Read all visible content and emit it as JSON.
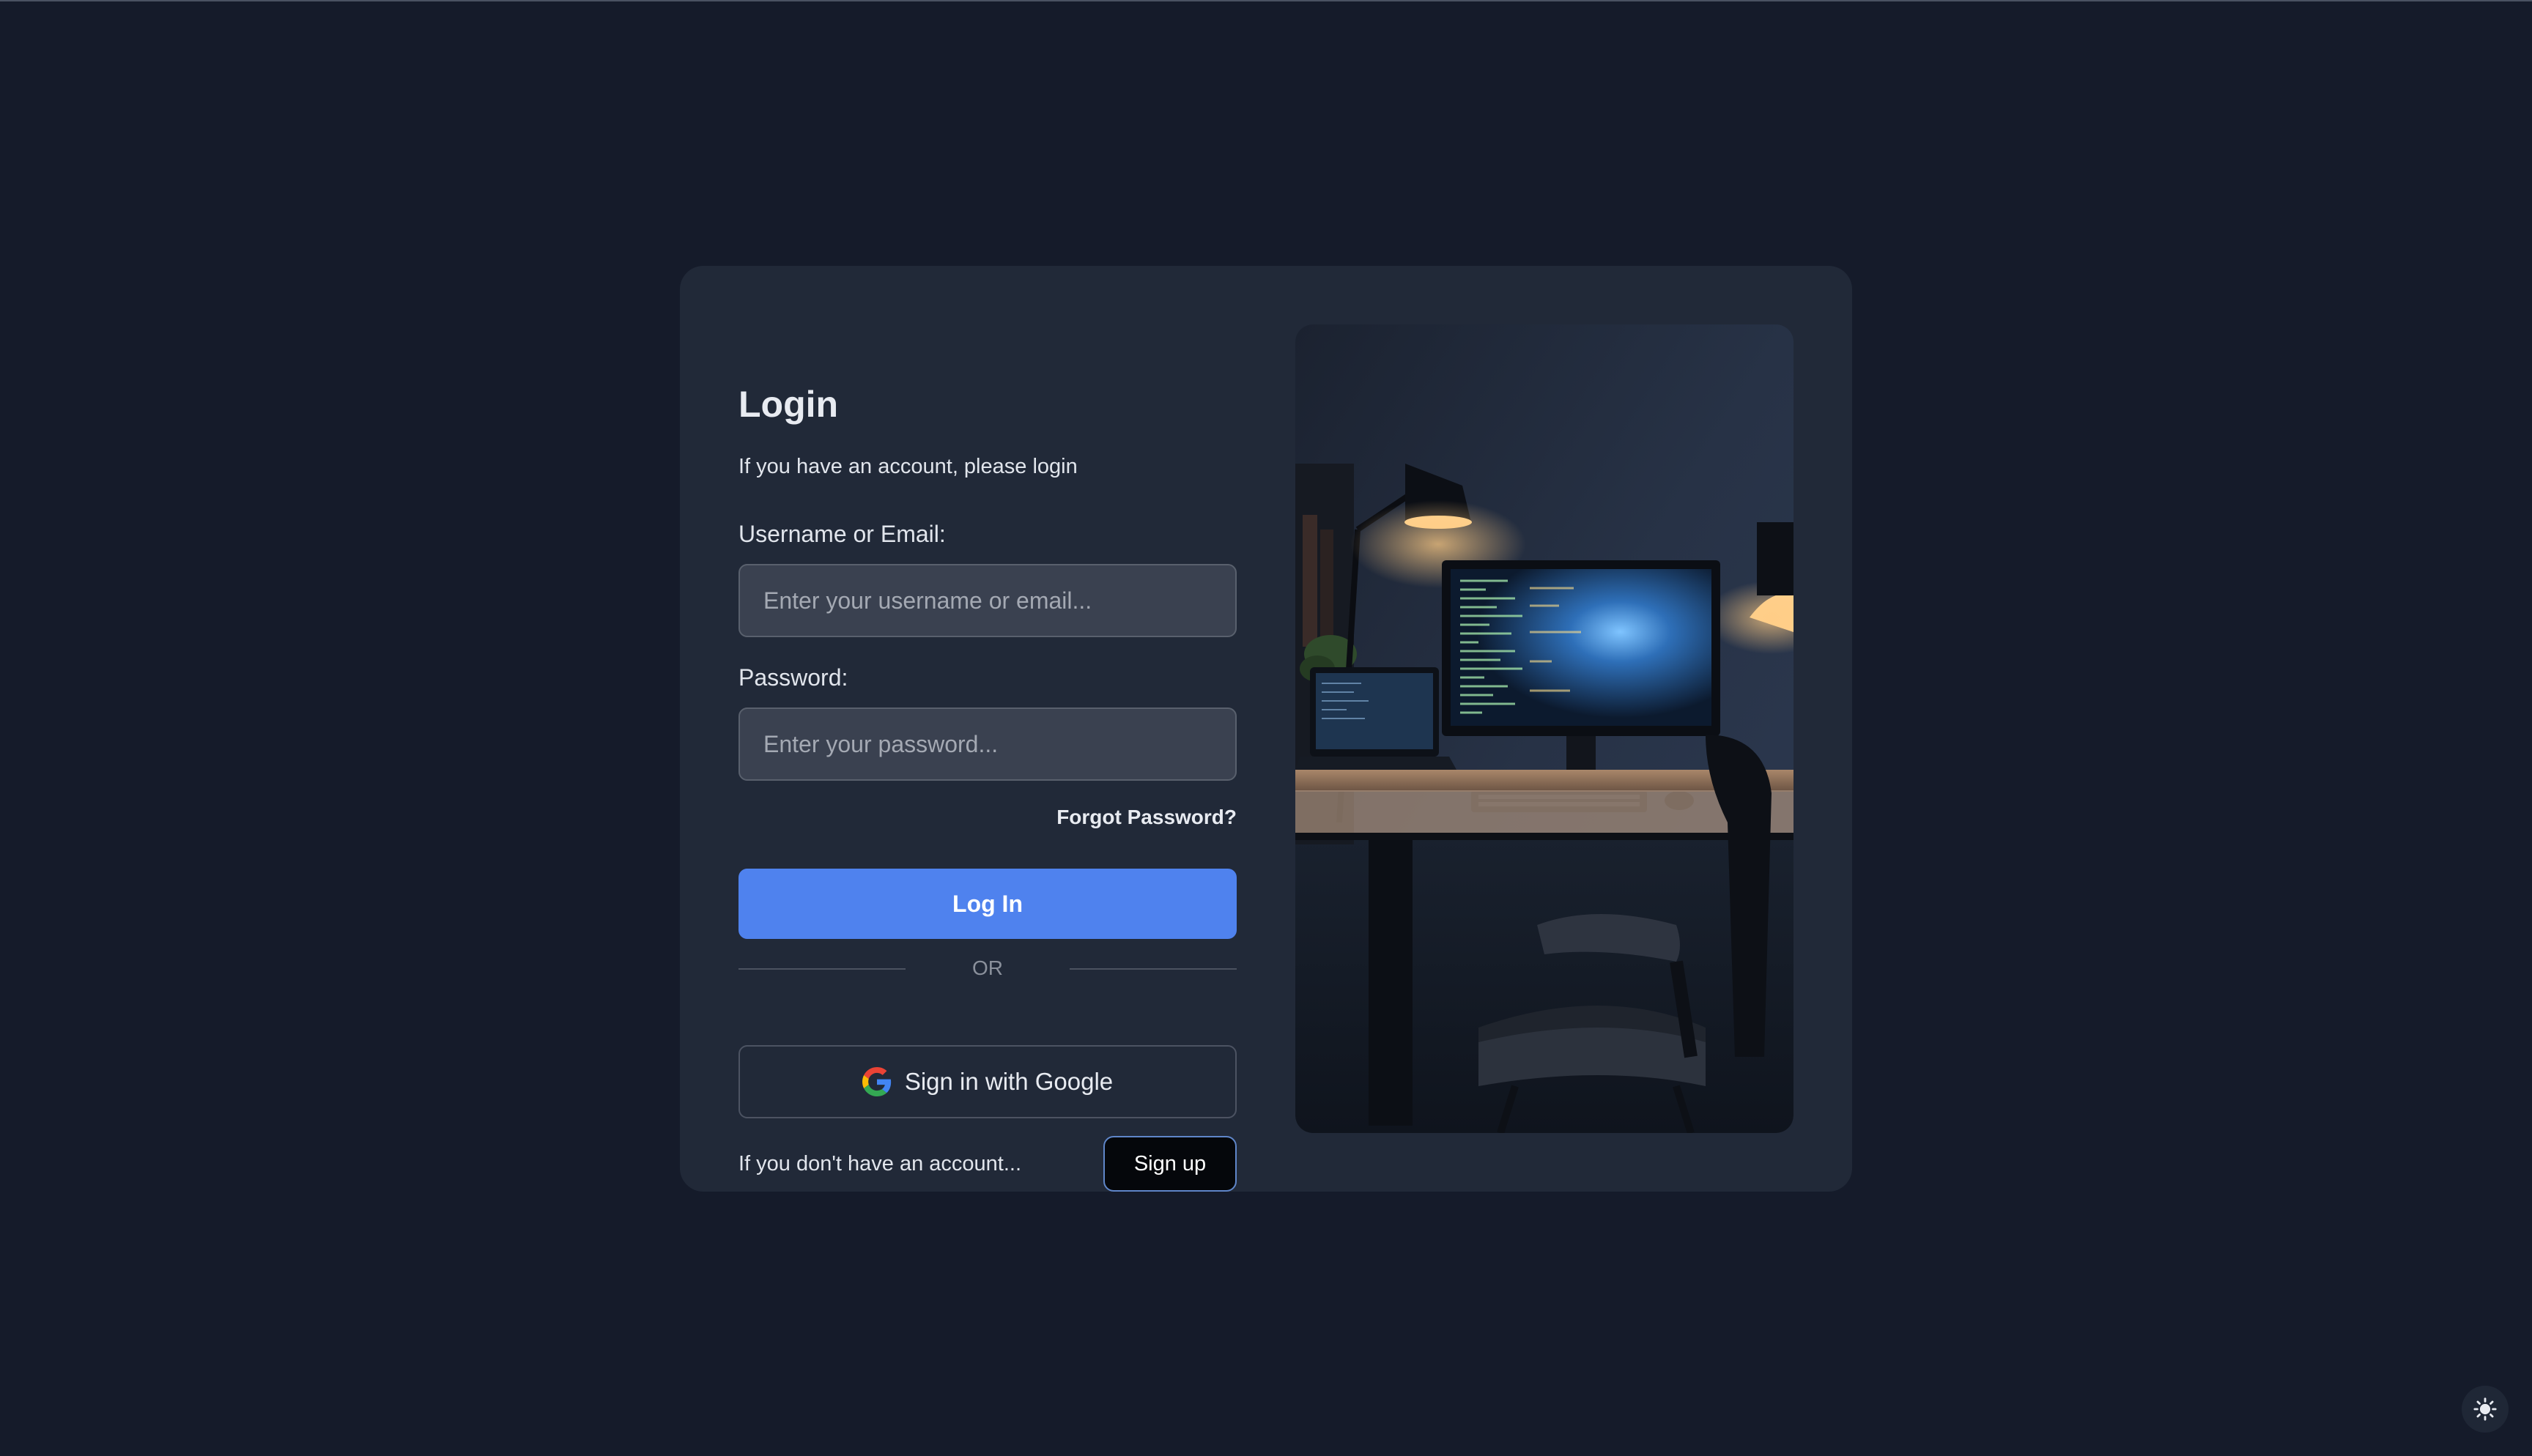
{
  "login": {
    "title": "Login",
    "subtitle": "If you have an account, please login",
    "username_label": "Username or Email:",
    "username_placeholder": "Enter your username or email...",
    "password_label": "Password:",
    "password_placeholder": "Enter your password...",
    "forgot_label": "Forgot Password?",
    "login_button": "Log In",
    "divider_text": "OR",
    "google_button": "Sign in with Google",
    "signup_prompt": "If you don't have an account...",
    "signup_button": "Sign up"
  },
  "icons": {
    "google": "google-g-icon",
    "theme": "sun-icon"
  },
  "colors": {
    "page_bg": "#151b2a",
    "card_bg": "#212938",
    "primary": "#4f82ee",
    "input_bg": "#3a4150"
  }
}
